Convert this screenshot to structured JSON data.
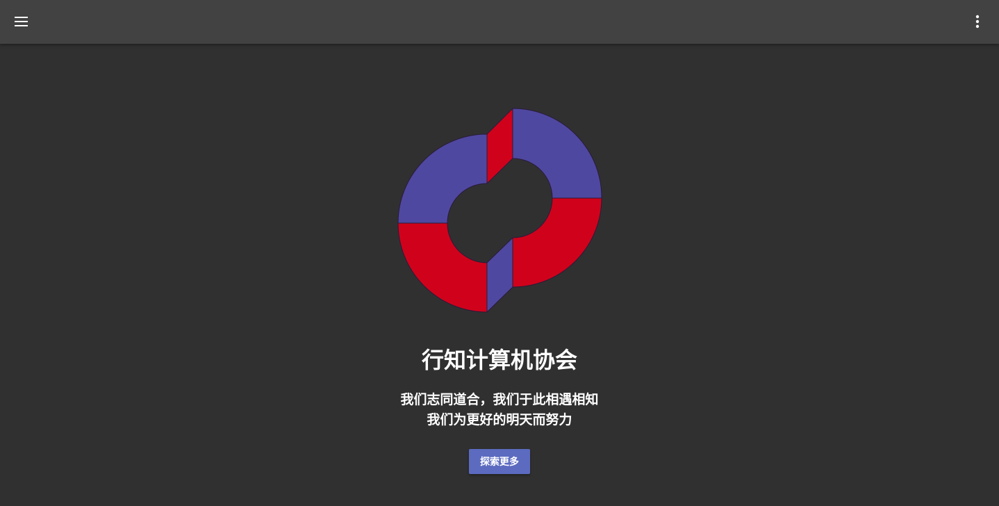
{
  "appbar": {
    "menu_icon": "menu-icon",
    "more_icon": "more-vert-icon"
  },
  "logo": {
    "colors": {
      "purple": "#4f48a0",
      "red": "#d0021b",
      "outline": "#2a1a3a"
    }
  },
  "hero": {
    "title": "行知计算机协会",
    "subtitle_line1": "我们志同道合，我们于此相遇相知",
    "subtitle_line2": "我们为更好的明天而努力",
    "explore_label": "探索更多"
  },
  "colors": {
    "background": "#303030",
    "appbar": "#424242",
    "button": "#5c6bc0",
    "text": "#ffffff"
  }
}
